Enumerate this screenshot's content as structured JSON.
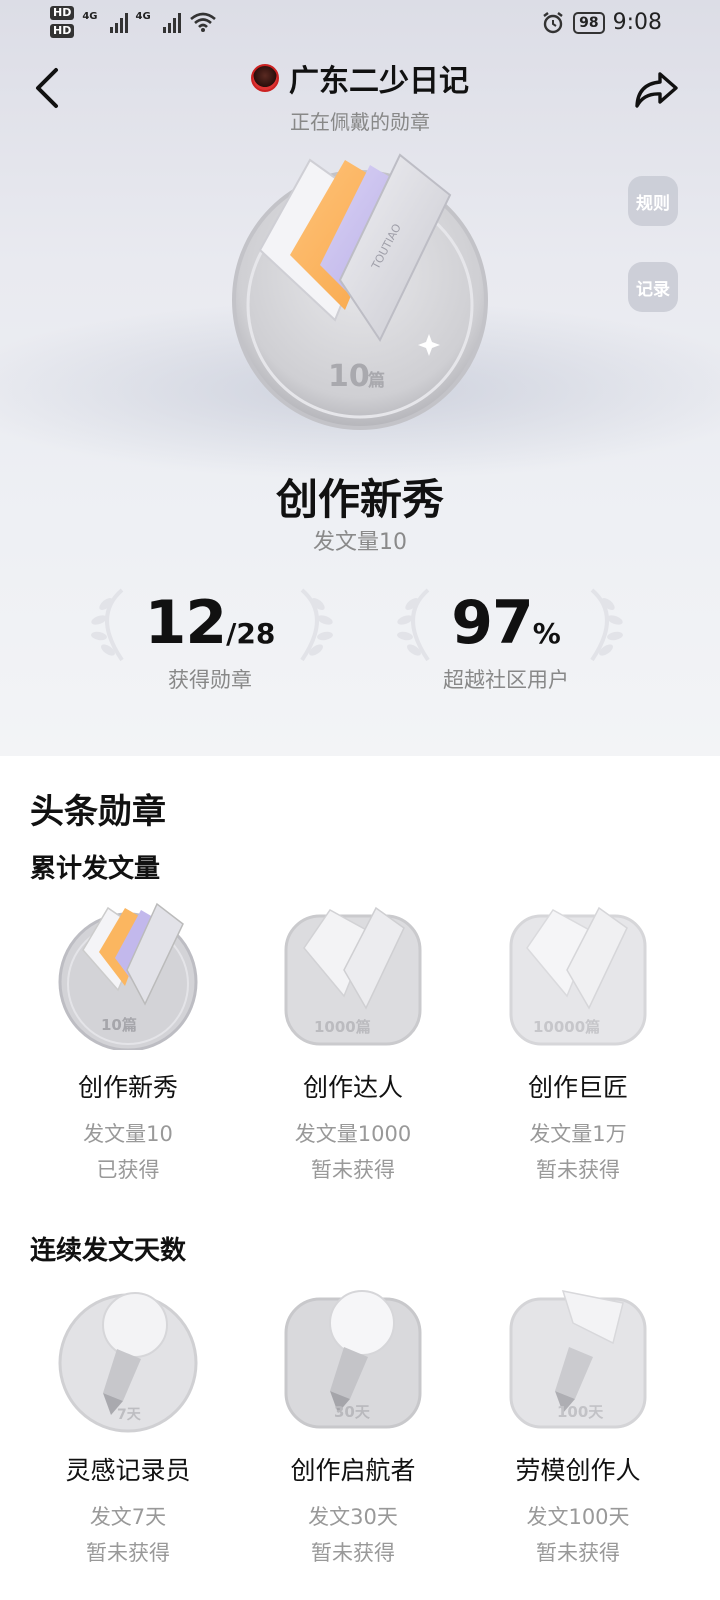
{
  "status_bar": {
    "hd1": "HD",
    "hd2": "HD",
    "net1": "4G",
    "net2": "4G",
    "battery": "98",
    "time": "9:08"
  },
  "header": {
    "title": "广东二少日记",
    "subtitle": "正在佩戴的勋章"
  },
  "side_buttons": {
    "rules": "规则",
    "records": "记录"
  },
  "featured": {
    "medal_count": "10",
    "medal_unit": "篇",
    "medal_brand": "TOUTIAO",
    "name": "创作新秀",
    "desc": "发文量10"
  },
  "stats": {
    "earned_num": "12",
    "earned_total": "/28",
    "earned_label": "获得勋章",
    "beat_num": "97",
    "beat_unit": "%",
    "beat_label": "超越社区用户"
  },
  "section": {
    "title": "头条勋章",
    "group1_title": "累计发文量",
    "group2_title": "连续发文天数"
  },
  "badges_group1": [
    {
      "medal_text": "10篇",
      "name": "创作新秀",
      "desc": "发文量10",
      "status": "已获得"
    },
    {
      "medal_text": "1000篇",
      "name": "创作达人",
      "desc": "发文量1000",
      "status": "暂未获得"
    },
    {
      "medal_text": "10000篇",
      "name": "创作巨匠",
      "desc": "发文量1万",
      "status": "暂未获得"
    }
  ],
  "badges_group2": [
    {
      "medal_text": "7天",
      "name": "灵感记录员",
      "desc": "发文7天",
      "status": "暂未获得"
    },
    {
      "medal_text": "30天",
      "name": "创作启航者",
      "desc": "发文30天",
      "status": "暂未获得"
    },
    {
      "medal_text": "100天",
      "name": "劳模创作人",
      "desc": "发文100天",
      "status": "暂未获得"
    }
  ]
}
